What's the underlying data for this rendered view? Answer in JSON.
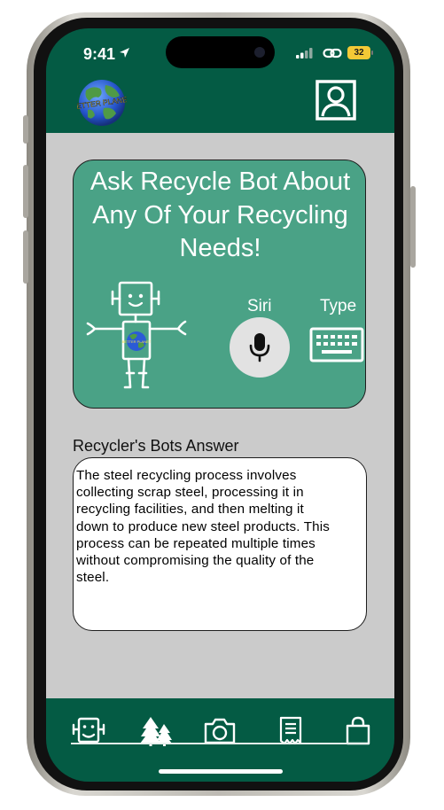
{
  "status_bar": {
    "time": "9:41",
    "battery": "32"
  },
  "header": {
    "logo_text": "BETTER PLANET"
  },
  "bot_card": {
    "title_lines": [
      "Ask Recycle Bot About",
      "Any Of Your Recycling",
      "Needs!"
    ],
    "robot_badge_text": "BETTER PLANET",
    "siri_label": "Siri",
    "type_label": "Type"
  },
  "answer": {
    "heading": "Recycler's Bots Answer",
    "lines": [
      "The steel recycling process involves",
      "collecting scrap steel, processing it in",
      "recycling facilities, and then melting it",
      "down to produce new steel products. This",
      "process can be repeated multiple times",
      "without compromising the quality of the",
      "steel."
    ]
  },
  "tab_bar": {
    "icons": [
      "robot-icon",
      "trees-icon",
      "camera-icon",
      "receipt-icon",
      "shopping-bag-icon"
    ]
  },
  "colors": {
    "brand_green": "#045b44",
    "card_green": "#4aa286",
    "content_gray": "#cbcbcb",
    "battery_yellow": "#f3c936"
  }
}
